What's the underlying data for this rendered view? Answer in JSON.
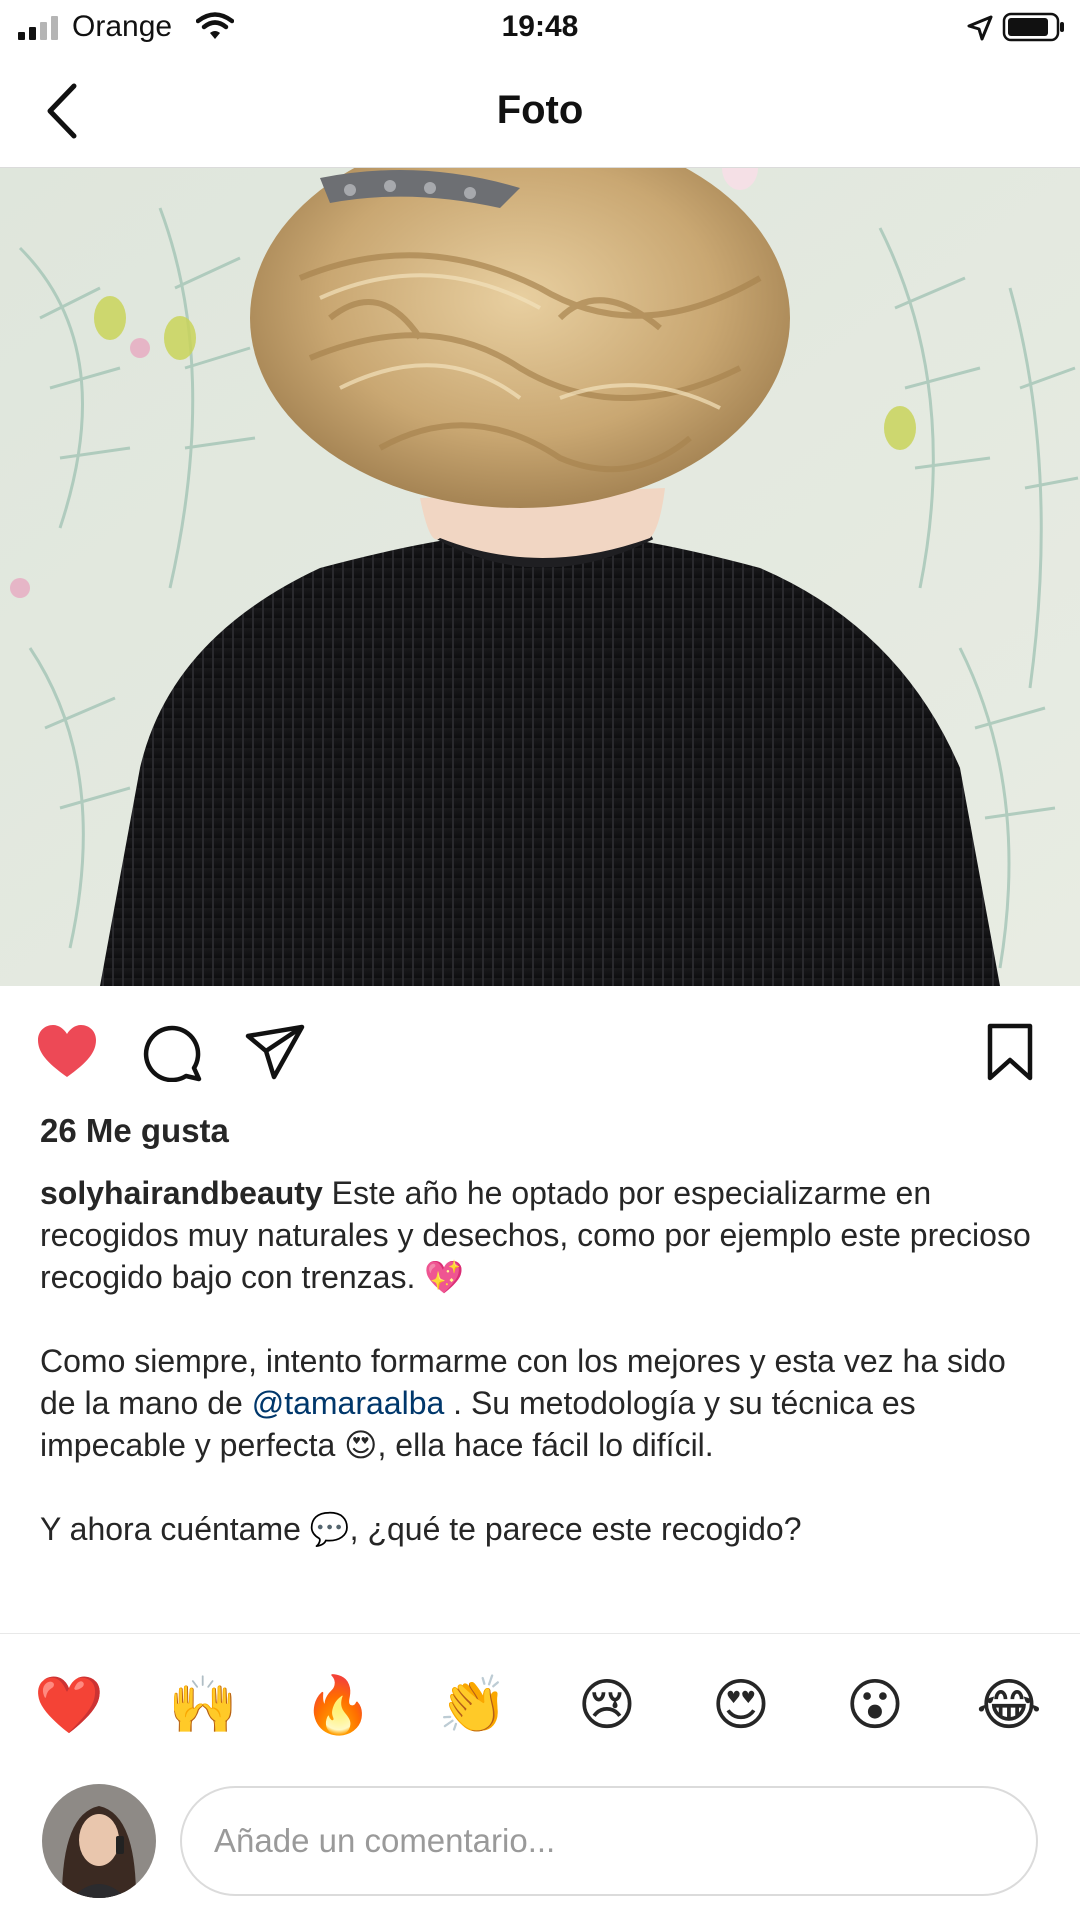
{
  "status_bar": {
    "carrier": "Orange",
    "time": "19:48",
    "icons": [
      "signal-icon",
      "wifi-icon",
      "location-arrow-icon",
      "battery-icon"
    ]
  },
  "nav": {
    "title": "Foto",
    "back_icon": "chevron-left-icon"
  },
  "photo": {
    "subject": "braided-updo-hairstyle"
  },
  "actions": {
    "liked": true,
    "like_color": "#ed4956",
    "icons": [
      "heart-icon",
      "comment-icon",
      "share-icon",
      "bookmark-icon"
    ]
  },
  "post": {
    "likes_text": "26 Me gusta",
    "username": "solyhairandbeauty",
    "caption_p1": " Este año he optado por especializarme en recogidos muy naturales y desechos, como por ejemplo este precioso recogido bajo con trenzas. 💖",
    "caption_p2_before": "Como siempre, intento formarme con los mejores y esta vez ha sido de la mano de ",
    "mention": "@tamaraalba",
    "caption_p2_after": " . Su metodología y su técnica es impecable y perfecta 😍, ella hace fácil lo difícil.",
    "caption_p3": "Y ahora cuéntame 💬, ¿qué te parece este recogido?"
  },
  "reactions": [
    "❤️",
    "🙌",
    "🔥",
    "👏",
    "😢",
    "😍",
    "😮",
    "😂"
  ],
  "comment": {
    "placeholder": "Añade un comentario...",
    "value": ""
  },
  "colors": {
    "mention": "#00376b",
    "text": "#262626"
  }
}
